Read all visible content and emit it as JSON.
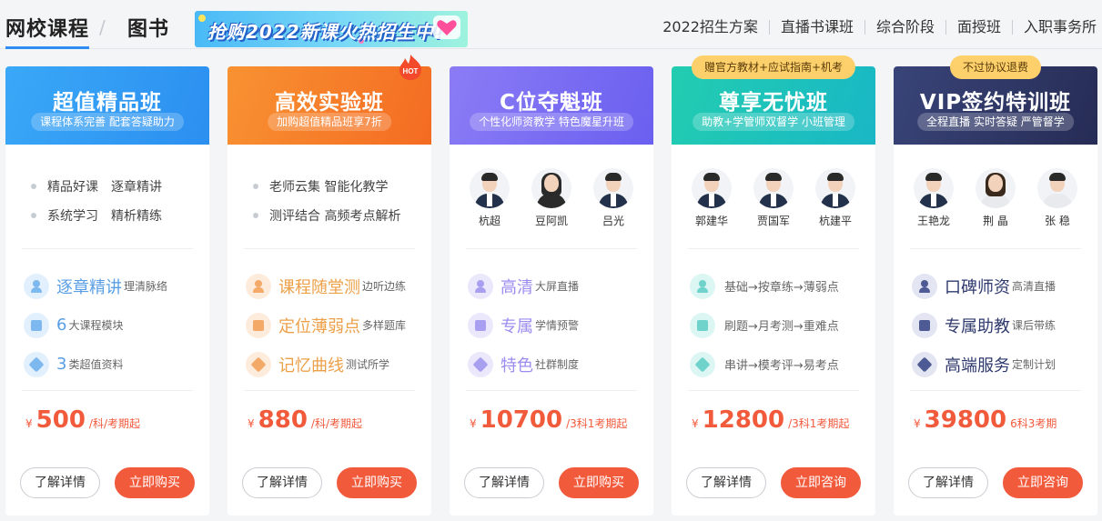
{
  "header": {
    "tab_active": "网校课程",
    "tab_sep": "/",
    "tab_books": "图书",
    "banner_text": "抢购2022新课火热招生中!",
    "nav": [
      "2022招生方案",
      "直播书课班",
      "综合阶段",
      "面授班",
      "入职事务所"
    ]
  },
  "colors": {
    "price": "#f25a3c",
    "card1": "#2f9cf2",
    "card2": "#f47c2b",
    "card3": "#7a6af2",
    "card4": "#1ec6b6",
    "card5": "#2c3566"
  },
  "cards": [
    {
      "title": "超值精品班",
      "subtitle": "课程体系完善 配套答疑助力",
      "features": [
        [
          "精品好课",
          "逐章精讲"
        ],
        [
          "系统学习",
          "精析精练"
        ]
      ],
      "benefits": [
        {
          "main": "逐章精讲",
          "small": "理清脉络",
          "icon": "person-icon"
        },
        {
          "main": "6",
          "small": "大课程模块",
          "icon": "book-icon"
        },
        {
          "main": "3",
          "small": "类超值资料",
          "icon": "heart-icon"
        }
      ],
      "currency": "¥",
      "price": "500",
      "price_unit": "/科/考期起",
      "btn_detail": "了解详情",
      "btn_action": "立即购买"
    },
    {
      "title": "高效实验班",
      "subtitle": "加购超值精品班享7折",
      "badge": "HOT",
      "features": [
        [
          "老师云集 智能化教学"
        ],
        [
          "测评结合 高频考点解析"
        ]
      ],
      "benefits": [
        {
          "main": "课程随堂测",
          "small": "边听边练",
          "icon": "person-icon"
        },
        {
          "main": "定位薄弱点",
          "small": "多样题库",
          "icon": "book-icon"
        },
        {
          "main": "记忆曲线",
          "small": "测试所学",
          "icon": "heart-icon"
        }
      ],
      "currency": "¥",
      "price": "880",
      "price_unit": "/科/考期起",
      "btn_detail": "了解详情",
      "btn_action": "立即购买"
    },
    {
      "title": "C位夺魁班",
      "subtitle": "个性化师资教学 特色魔星升班",
      "teachers": [
        "杭超",
        "豆阿凯",
        "吕光"
      ],
      "benefits": [
        {
          "main": "高清",
          "small": "大屏直播",
          "icon": "person-icon"
        },
        {
          "main": "专属",
          "small": "学情预警",
          "icon": "book-icon"
        },
        {
          "main": "特色",
          "small": "社群制度",
          "icon": "heart-icon"
        }
      ],
      "currency": "¥",
      "price": "10700",
      "price_unit": "/3科1考期起",
      "btn_detail": "了解详情",
      "btn_action": "立即购买"
    },
    {
      "title": "尊享无忧班",
      "subtitle": "助教+学管师双督学 小班管理",
      "ribbon": "赠官方教材+应试指南+机考",
      "teachers": [
        "郭建华",
        "贾国军",
        "杭建平"
      ],
      "benefits": [
        {
          "main": "",
          "small": "基础→按章练→薄弱点",
          "icon": "person-icon"
        },
        {
          "main": "",
          "small": "刷题→月考测→重难点",
          "icon": "book-icon"
        },
        {
          "main": "",
          "small": "串讲→模考评→易考点",
          "icon": "heart-icon"
        }
      ],
      "currency": "¥",
      "price": "12800",
      "price_unit": "/3科1考期起",
      "btn_detail": "了解详情",
      "btn_action": "立即咨询"
    },
    {
      "title": "VIP签约特训班",
      "subtitle": "全程直播 实时答疑 严管督学",
      "ribbon": "不过协议退费",
      "teachers": [
        "王艳龙",
        "荆 晶",
        "张 稳"
      ],
      "benefits": [
        {
          "main": "口碑师资",
          "small": "高清直播",
          "icon": "person-icon"
        },
        {
          "main": "专属助教",
          "small": "课后带练",
          "icon": "book-icon"
        },
        {
          "main": "高端服务",
          "small": "定制计划",
          "icon": "heart-icon"
        }
      ],
      "currency": "¥",
      "price": "39800",
      "price_unit": "6科3考期",
      "btn_detail": "了解详情",
      "btn_action": "立即咨询"
    }
  ]
}
